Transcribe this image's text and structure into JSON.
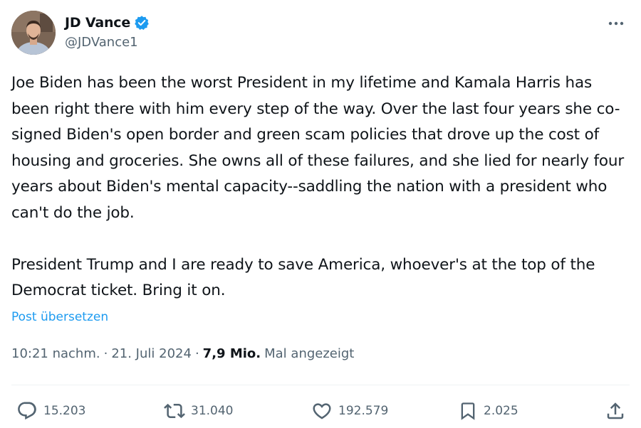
{
  "author": {
    "display_name": "JD Vance",
    "handle": "@JDVance1",
    "verified": true,
    "verified_color": "#1d9bf0"
  },
  "tweet": {
    "text": "Joe Biden has been the worst President in my lifetime and Kamala Harris has been right there with him every step of the way. Over the last four years she co-signed Biden's open border and green scam policies that drove up the cost of housing and groceries. She owns all of these failures, and she lied for nearly four years about Biden's mental capacity--saddling the nation with a president who can't do the job.\n\nPresident Trump and I are ready to save America, whoever's at the top of the Democrat ticket. Bring it on.",
    "translate_label": "Post übersetzen"
  },
  "meta": {
    "time": "10:21 nachm.",
    "date": "21. Juli 2024",
    "views_count": "7,9 Mio.",
    "views_label": "Mal angezeigt",
    "separator": "·"
  },
  "actions": {
    "replies": "15.203",
    "reposts": "31.040",
    "likes": "192.579",
    "bookmarks": "2.025"
  },
  "icons": {
    "more": "more-horizontal-icon",
    "reply": "reply-icon",
    "repost": "repost-icon",
    "like": "heart-icon",
    "bookmark": "bookmark-icon",
    "share": "share-icon",
    "verified": "verified-badge-icon"
  },
  "colors": {
    "link": "#1d9bf0",
    "text": "#0f1419",
    "secondary": "#536471"
  }
}
